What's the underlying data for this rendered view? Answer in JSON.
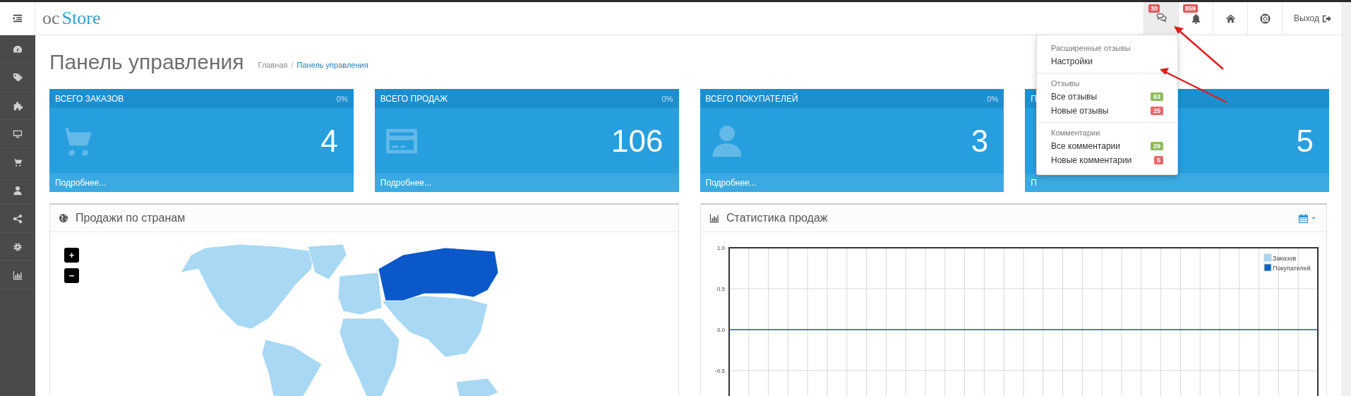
{
  "header": {
    "logo": {
      "prefix": "oc",
      "name": "Store"
    },
    "nav": [
      {
        "kind": "reviews",
        "badge": "30",
        "selected": true
      },
      {
        "kind": "alerts",
        "badge": "859",
        "selected": false
      },
      {
        "kind": "home",
        "selected": false
      },
      {
        "kind": "help",
        "selected": false
      },
      {
        "kind": "logout",
        "label": "Выход",
        "selected": false
      }
    ]
  },
  "dropdown": {
    "sections": [
      {
        "heading": "Расширенные отзывы",
        "items": [
          {
            "label": "Настройки"
          }
        ]
      },
      {
        "heading": "Отзывы",
        "items": [
          {
            "label": "Все отзывы",
            "badge": "63",
            "color": "#8fbb5e"
          },
          {
            "label": "Новые отзывы",
            "badge": "25",
            "color": "#e9676a"
          }
        ]
      },
      {
        "heading": "Комментарии",
        "items": [
          {
            "label": "Все комментарии",
            "badge": "29",
            "color": "#8fbb5e"
          },
          {
            "label": "Новые комментарии",
            "badge": "5",
            "color": "#e9676a"
          }
        ]
      }
    ]
  },
  "page": {
    "title": "Панель управления",
    "separator": "/",
    "breadcrumbs": [
      {
        "label": "Главная",
        "selected": false
      },
      {
        "label": "Панель управления",
        "selected": true
      }
    ]
  },
  "tiles": [
    {
      "kind": "orders",
      "title": "ВСЕГО ЗАКАЗОВ",
      "percent": "0%",
      "value": "4",
      "footer": "Подробнее..."
    },
    {
      "kind": "sales",
      "title": "ВСЕГО ПРОДАЖ",
      "percent": "0%",
      "value": "106",
      "footer": "Подробнее..."
    },
    {
      "kind": "customers",
      "title": "ВСЕГО ПОКУПАТЕЛЕЙ",
      "percent": "0%",
      "value": "3",
      "footer": "Подробнее..."
    },
    {
      "kind": "other",
      "title": "П",
      "value": "5",
      "footer": "П"
    }
  ],
  "map_panel": {
    "title": "Продажи по странам",
    "zoom_buttons": [
      "+",
      "−"
    ]
  },
  "chart_panel": {
    "title": "Статистика продаж",
    "chart_data": {
      "type": "line",
      "grid": true,
      "legend": true,
      "ylim": [
        -1,
        1
      ],
      "yticks": [
        {
          "value": 1,
          "label": "1.0"
        },
        {
          "value": 0.5,
          "label": "0.5"
        },
        {
          "value": 0,
          "label": "0.0"
        },
        {
          "value": -0.5,
          "label": "-0.5"
        }
      ],
      "series": [
        {
          "name": "Заказов",
          "color": "#a6d6f2",
          "values": [
            null,
            null,
            null,
            null,
            null,
            null,
            null,
            null,
            null,
            null,
            null,
            null,
            null,
            null,
            null,
            null,
            null,
            null,
            null,
            null,
            null,
            null,
            null,
            null,
            null,
            null,
            null,
            null,
            null,
            null,
            null
          ]
        },
        {
          "name": "Покупателей",
          "color": "#0f62c2",
          "values": [
            0,
            0,
            0,
            0,
            0,
            0,
            0,
            0,
            0,
            0,
            0,
            0,
            0,
            0,
            0,
            0,
            0,
            0,
            0,
            0,
            0,
            0,
            0,
            0,
            0,
            0,
            0,
            0,
            0,
            0,
            0
          ]
        }
      ]
    }
  }
}
